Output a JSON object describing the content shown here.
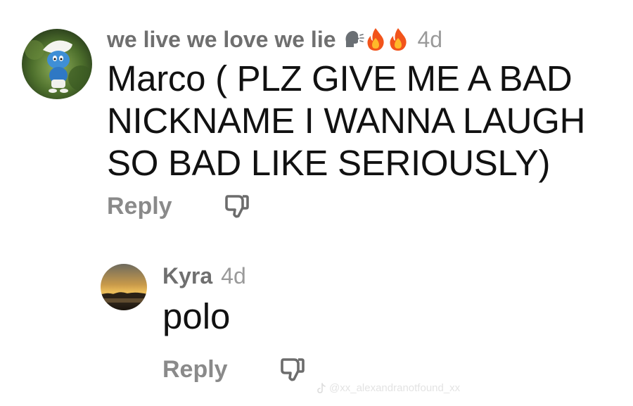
{
  "comments": [
    {
      "username": "we live we love we lie",
      "emojis": [
        "speaking-head",
        "fire",
        "fire"
      ],
      "time": "4d",
      "lines": [
        "Marco ( PLZ GIVE ME A BAD",
        "NICKNAME I WANNA LAUGH",
        "SO BAD LIKE SERIOUSLY)"
      ],
      "reply_label": "Reply",
      "dislike_icon": "thumbs-down-icon"
    },
    {
      "username": "Kyra",
      "time": "4d",
      "text": "polo",
      "reply_label": "Reply",
      "dislike_icon": "thumbs-down-icon"
    }
  ],
  "watermark": {
    "text": "@xx_alexandranotfound_xx",
    "icon": "tiktok-logo"
  },
  "colors": {
    "username": "#6f6f6f",
    "timestamp": "#9a9a9a",
    "comment_text": "#111111",
    "reply_label": "#8a8a8a"
  }
}
